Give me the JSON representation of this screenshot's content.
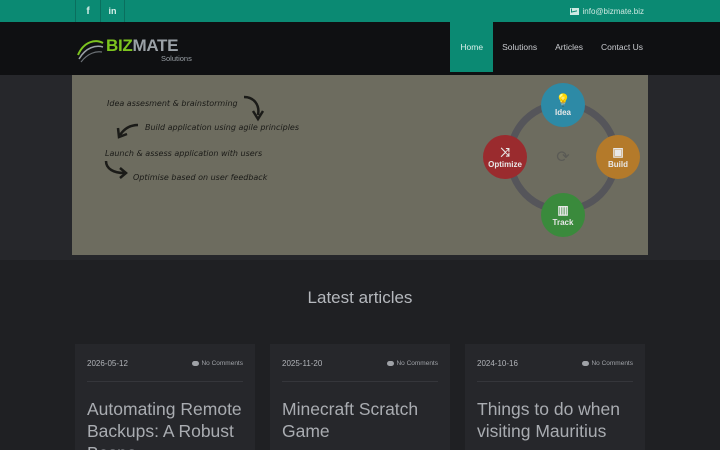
{
  "topbar": {
    "social": [
      {
        "icon": "facebook-icon",
        "glyph": "f"
      },
      {
        "icon": "linkedin-icon",
        "glyph": "in"
      }
    ],
    "email": "info@bizmate.biz"
  },
  "brand": {
    "part1": "BIZ",
    "part2": "MATE",
    "sub": "Solutions",
    "colors": {
      "green": "#7dc41f",
      "grey": "#9aa0a6"
    }
  },
  "nav": {
    "items": [
      {
        "label": "Home",
        "active": true
      },
      {
        "label": "Solutions"
      },
      {
        "label": "Articles"
      },
      {
        "label": "Contact Us"
      }
    ]
  },
  "hero": {
    "steps": [
      "Idea assesment & brainstorming",
      "Build application using agile principles",
      "Launch & assess application with users",
      "Optimise based on user feedback"
    ],
    "cycle": [
      {
        "label": "Idea",
        "icon": "lightbulb-icon",
        "color": "#2d8aa6"
      },
      {
        "label": "Build",
        "icon": "image-icon",
        "color": "#b47a2a"
      },
      {
        "label": "Track",
        "icon": "bar-chart-icon",
        "color": "#3a8a3c"
      },
      {
        "label": "Optimize",
        "icon": "shuffle-icon",
        "color": "#9a2b2e"
      }
    ]
  },
  "articles": {
    "heading": "Latest articles",
    "cards": [
      {
        "date": "2026-05-12",
        "comments": "No Comments",
        "title": "Automating Remote Backups: A Robust Bespo"
      },
      {
        "date": "2025-11-20",
        "comments": "No Comments",
        "title": "Minecraft Scratch Game"
      },
      {
        "date": "2024-10-16",
        "comments": "No Comments",
        "title": "Things to do when visiting Mauritius"
      }
    ]
  },
  "accent": "#0b8a73"
}
